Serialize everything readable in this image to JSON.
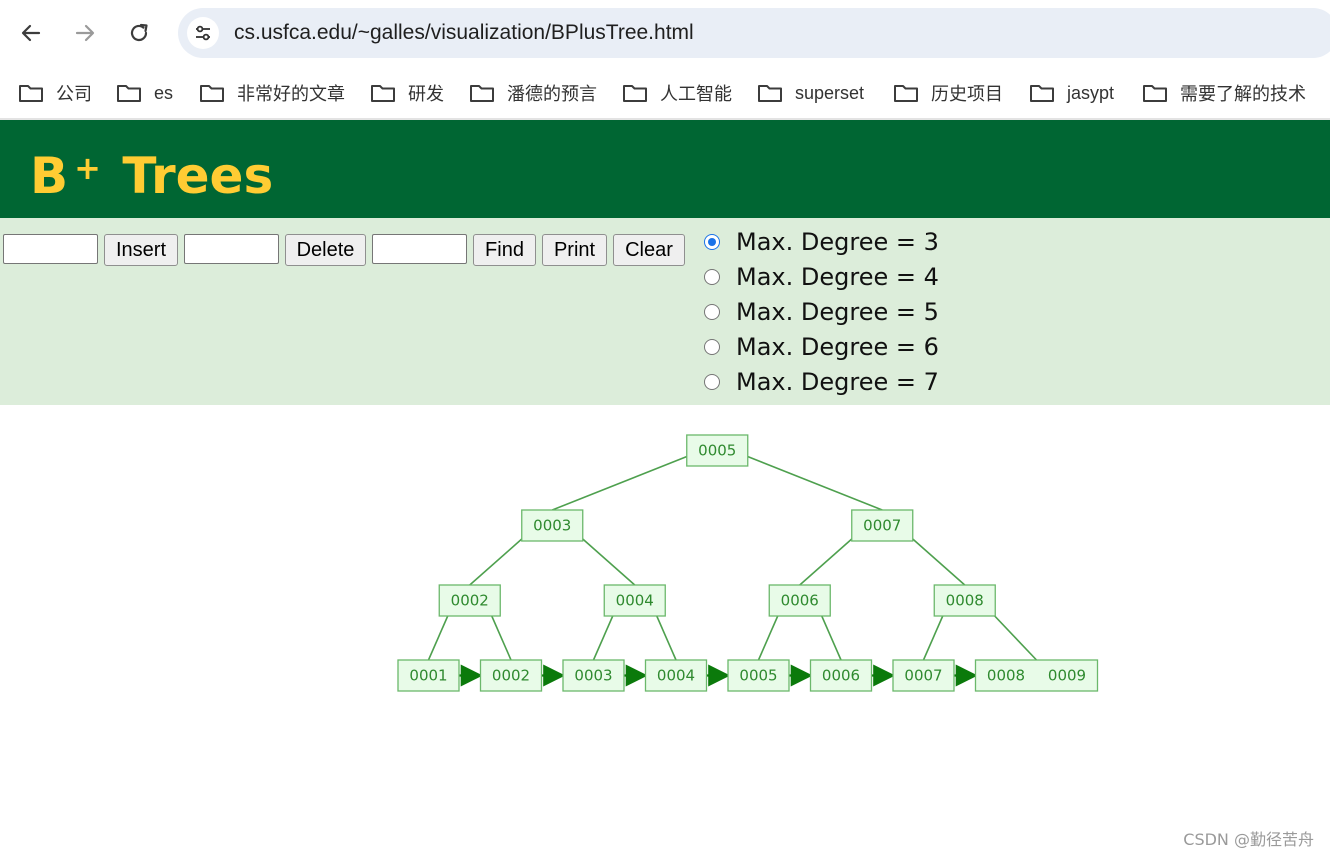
{
  "browser": {
    "url": "cs.usfca.edu/~galles/visualization/BPlusTree.html",
    "bookmarks": [
      "公司",
      "es",
      "非常好的文章",
      "研发",
      "潘德的预言",
      "人工智能",
      "superset",
      "历史项目",
      "jasypt",
      "需要了解的技术"
    ]
  },
  "page": {
    "title_main": "B",
    "title_sup": "+",
    "title_rest": "Trees"
  },
  "controls": {
    "insert_label": "Insert",
    "delete_label": "Delete",
    "find_label": "Find",
    "print_label": "Print",
    "clear_label": "Clear",
    "insert_value": "",
    "delete_value": "",
    "find_value": "",
    "degrees": [
      {
        "label": "Max. Degree = 3",
        "checked": true
      },
      {
        "label": "Max. Degree = 4",
        "checked": false
      },
      {
        "label": "Max. Degree = 5",
        "checked": false
      },
      {
        "label": "Max. Degree = 6",
        "checked": false
      },
      {
        "label": "Max. Degree = 7",
        "checked": false
      }
    ]
  },
  "tree": {
    "levels": [
      [
        {
          "keys": [
            "0005"
          ],
          "children": [
            0,
            1
          ]
        }
      ],
      [
        {
          "keys": [
            "0003"
          ],
          "children": [
            0,
            1
          ]
        },
        {
          "keys": [
            "0007"
          ],
          "children": [
            2,
            3
          ]
        }
      ],
      [
        {
          "keys": [
            "0002"
          ],
          "children": [
            0,
            1
          ]
        },
        {
          "keys": [
            "0004"
          ],
          "children": [
            2,
            3
          ]
        },
        {
          "keys": [
            "0006"
          ],
          "children": [
            4,
            5
          ]
        },
        {
          "keys": [
            "0008"
          ],
          "children": [
            6,
            7
          ]
        }
      ],
      [
        {
          "keys": [
            "0001"
          ]
        },
        {
          "keys": [
            "0002"
          ]
        },
        {
          "keys": [
            "0003"
          ]
        },
        {
          "keys": [
            "0004"
          ]
        },
        {
          "keys": [
            "0005"
          ]
        },
        {
          "keys": [
            "0006"
          ]
        },
        {
          "keys": [
            "0007"
          ]
        },
        {
          "keys": [
            "0008",
            "0009"
          ]
        }
      ]
    ]
  },
  "colors": {
    "header_bg": "#006633",
    "title": "#ffcc33",
    "controls_bg": "#dcedda",
    "node_fill": "#e8fbe8",
    "node_border": "#6bb86b",
    "edge": "#4ea04e",
    "node_text": "#2f8a2f",
    "arrow": "#0b7a0b"
  },
  "watermark": "CSDN @勤径苦舟"
}
